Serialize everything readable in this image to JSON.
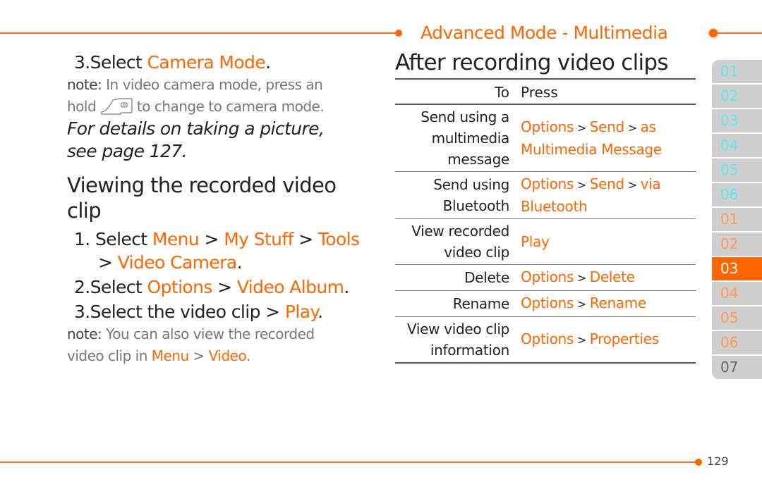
{
  "header": {
    "section_title": "Advanced Mode - Multimedia",
    "accent_color": "#ff6600"
  },
  "left": {
    "step3_camera": {
      "num": "3.",
      "prefix": "Select ",
      "link": "Camera Mode",
      "suffix": "."
    },
    "note1": {
      "label": "note:",
      "line1": " In video camera mode, press an",
      "line2_a": "hold ",
      "line2_b": " to change to camera mode."
    },
    "italic_ref": {
      "line1": "For details on taking a picture,",
      "line2": "see page 127."
    },
    "heading": "Viewing the recorded video clip",
    "steps": [
      {
        "num": "1.",
        "text": "Select ",
        "parts": [
          "Menu",
          " > ",
          "My Stuff",
          " > ",
          "Tools",
          " > ",
          "Video Camera",
          "."
        ]
      },
      {
        "num": "2.",
        "text": "Select ",
        "parts": [
          "Options",
          " > ",
          "Video Album",
          "."
        ]
      },
      {
        "num": "3.",
        "text": "Select the video clip > ",
        "parts": [
          "Play",
          "."
        ]
      }
    ],
    "note2": {
      "label": "note:",
      "line1": " You can also view the recorded",
      "line2_prefix": "video clip in ",
      "link1": "Menu",
      "sep": " > ",
      "link2": "Video",
      "end": "."
    }
  },
  "right": {
    "title": "After recording video clips",
    "table": {
      "headers": [
        "To",
        "Press"
      ],
      "rows": [
        {
          "to": "Send using a multimedia message",
          "press": [
            "Options",
            " > ",
            "Send",
            " > ",
            "as Multimedia Message"
          ]
        },
        {
          "to": "Send using Bluetooth",
          "press": [
            "Options",
            " > ",
            "Send",
            " > ",
            "via Bluetooth"
          ]
        },
        {
          "to": "View recorded video clip",
          "press": [
            "Play"
          ]
        },
        {
          "to": "Delete",
          "press": [
            "Options",
            " > ",
            "Delete"
          ]
        },
        {
          "to": "Rename",
          "press": [
            "Options",
            " > ",
            "Rename"
          ]
        },
        {
          "to": "View video clip information",
          "press": [
            "Options",
            " > ",
            "Properties"
          ]
        }
      ]
    }
  },
  "tabs": [
    {
      "label": "01",
      "group": "cyan"
    },
    {
      "label": "02",
      "group": "cyan"
    },
    {
      "label": "03",
      "group": "cyan"
    },
    {
      "label": "04",
      "group": "cyan"
    },
    {
      "label": "05",
      "group": "cyan"
    },
    {
      "label": "06",
      "group": "cyan"
    },
    {
      "label": "01",
      "group": "orange"
    },
    {
      "label": "02",
      "group": "orange"
    },
    {
      "label": "03",
      "group": "active"
    },
    {
      "label": "04",
      "group": "orange"
    },
    {
      "label": "05",
      "group": "orange"
    },
    {
      "label": "06",
      "group": "orange"
    },
    {
      "label": "07",
      "group": "gray"
    }
  ],
  "footer": {
    "page_number": "129"
  }
}
